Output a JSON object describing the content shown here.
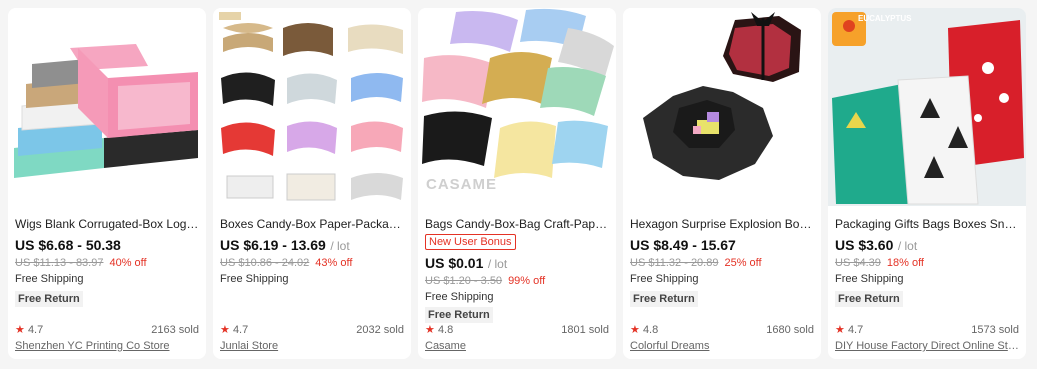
{
  "products": [
    {
      "title": "Wigs Blank Corrugated-Box Logo Custom Mailer Box",
      "price": "US $6.68 - 50.38",
      "unit": "",
      "promo": "",
      "original_price": "US $11.13 - 83.97",
      "discount": "40% off",
      "shipping": "Free Shipping",
      "return": "Free Return",
      "rating": "4.7",
      "sold": "2163 sold",
      "store": "Shenzhen YC Printing Co Store",
      "image": "colorful-mailer-boxes"
    },
    {
      "title": "Boxes Candy-Box Paper-Packaging Kraft Pillow",
      "price": "US $6.19 - 13.69",
      "unit": "/ lot",
      "promo": "",
      "original_price": "US $10.86 - 24.02",
      "discount": "43% off",
      "shipping": "Free Shipping",
      "return": "",
      "rating": "4.7",
      "sold": "2032 sold",
      "store": "Junlai Store",
      "image": "pillow-box-grid"
    },
    {
      "title": "Bags Candy-Box-Bag Craft-Paper Pillow Box",
      "price": "US $0.01",
      "unit": "/ lot",
      "promo": "New User Bonus",
      "original_price": "US $1.20 - 3.50",
      "discount": "99% off",
      "shipping": "Free Shipping",
      "return": "Free Return",
      "rating": "4.8",
      "sold": "1801 sold",
      "store": "Casame",
      "image": "pastel-pillow-boxes",
      "watermark": "CASAME"
    },
    {
      "title": "Hexagon Surprise Explosion Box DIY Scrapbook",
      "price": "US $8.49 - 15.67",
      "unit": "",
      "promo": "",
      "original_price": "US $11.32 - 20.89",
      "discount": "25% off",
      "shipping": "Free Shipping",
      "return": "Free Return",
      "rating": "4.8",
      "sold": "1680 sold",
      "store": "Colorful Dreams",
      "image": "explosion-box"
    },
    {
      "title": "Packaging Gifts Bags Boxes Snowflake Christmas",
      "price": "US $3.60",
      "unit": "/ lot",
      "promo": "",
      "original_price": "US $4.39",
      "discount": "18% off",
      "shipping": "Free Shipping",
      "return": "Free Return",
      "rating": "4.7",
      "sold": "1573 sold",
      "store": "DIY House Factory Direct Online Store",
      "image": "christmas-gift-bags",
      "watermark": "EUCALYPTUS"
    }
  ],
  "colors": {
    "accent": "#e43225",
    "star": "#e43225"
  }
}
